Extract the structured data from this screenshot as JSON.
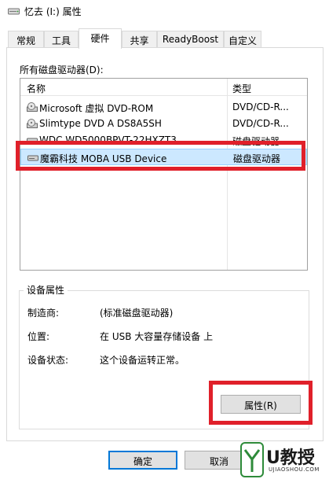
{
  "window": {
    "title": "忆去 (I:) 属性"
  },
  "tabs": [
    {
      "label": "常规"
    },
    {
      "label": "工具"
    },
    {
      "label": "硬件"
    },
    {
      "label": "共享"
    },
    {
      "label": "ReadyBoost"
    },
    {
      "label": "自定义"
    }
  ],
  "drives": {
    "label": "所有磁盘驱动器(D):",
    "col_name": "名称",
    "col_type": "类型",
    "rows": [
      {
        "name": "Microsoft 虚拟 DVD-ROM",
        "type": "DVD/CD-R...",
        "icon": "dvd-drive-icon"
      },
      {
        "name": "Slimtype DVD A  DS8A5SH",
        "type": "DVD/CD-R...",
        "icon": "dvd-drive-icon"
      },
      {
        "name": "WDC WD5000BPVT-22HXZT3",
        "type": "磁盘驱动器",
        "icon": "hard-disk-icon"
      },
      {
        "name": "魔霸科技 MOBA USB Device",
        "type": "磁盘驱动器",
        "icon": "hard-disk-icon"
      }
    ]
  },
  "device_props": {
    "group_label": "设备属性",
    "manufacturer_label": "制造商:",
    "manufacturer_value": "(标准磁盘驱动器)",
    "location_label": "位置:",
    "location_value": "在 USB 大容量存储设备 上",
    "status_label": "设备状态:",
    "status_value": "这个设备运转正常。"
  },
  "buttons": {
    "properties": "属性(R)",
    "ok": "确定",
    "cancel": "取消"
  },
  "watermark": {
    "brand": "U教授",
    "site": "UJIAOSHOU.COM"
  },
  "colors": {
    "highlight": "#e0202a",
    "selection": "#cce8ff",
    "accent": "#0078d7"
  }
}
